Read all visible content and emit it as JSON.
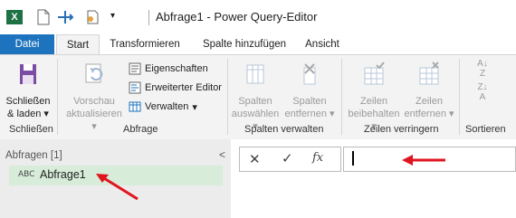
{
  "window": {
    "title": "Abfrage1 - Power Query-Editor",
    "app_icon_text": "X"
  },
  "tabs": [
    {
      "label": "Datei"
    },
    {
      "label": "Start"
    },
    {
      "label": "Transformieren"
    },
    {
      "label": "Spalte hinzufügen"
    },
    {
      "label": "Ansicht"
    }
  ],
  "ribbon": {
    "close": {
      "line1": "Schließen",
      "line2": "& laden",
      "group": "Schließen"
    },
    "query": {
      "preview_line1": "Vorschau",
      "preview_line2": "aktualisieren",
      "properties": "Eigenschaften",
      "advanced_editor": "Erweiterter Editor",
      "manage": "Verwalten",
      "group": "Abfrage"
    },
    "columns": {
      "select_line1": "Spalten",
      "select_line2": "auswählen",
      "remove_line1": "Spalten",
      "remove_line2": "entfernen",
      "group": "Spalten verwalten"
    },
    "rows": {
      "keep_line1": "Zeilen",
      "keep_line2": "beibehalten",
      "remove_line1": "Zeilen",
      "remove_line2": "entfernen",
      "group": "Zeilen verringern"
    },
    "sort": {
      "group": "Sortieren"
    }
  },
  "queries": {
    "header": "Abfragen [1]",
    "items": [
      {
        "type_icon": "ABC",
        "name": "Abfrage1"
      }
    ]
  },
  "formula_bar": {
    "fx_label": "fx",
    "value": ""
  },
  "colors": {
    "accent": "#1e73be",
    "excel_green": "#1e7145",
    "arrow": "#e0141e",
    "query_selected": "#d7ecd9"
  }
}
